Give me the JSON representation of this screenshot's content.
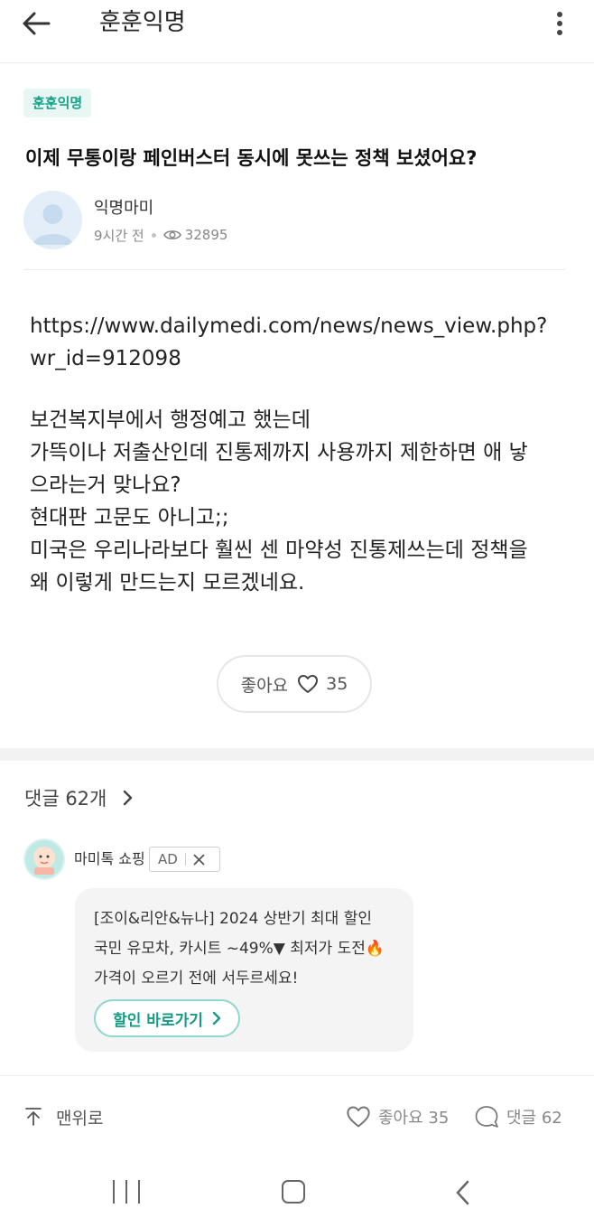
{
  "header": {
    "back_icon": "arrow-left-icon",
    "title": "훈훈익명",
    "more_icon": "more-vertical-icon"
  },
  "post": {
    "board_badge": "훈훈익명",
    "title": "이제 무통이랑 페인버스터 동시에 못쓰는 정책 보셨어요?",
    "author": "익명마미",
    "time": "9시간 전",
    "views": "32895",
    "link_lines": [
      "https://www.dailymedi.com/news/news_view.php?",
      "wr_id=912098"
    ],
    "body_lines": [
      "보건복지부에서 행정예고 했는데",
      "가뜩이나 저출산인데 진통제까지 사용까지 제한하면 애 낳",
      "으라는거 맞나요?",
      "현대판 고문도 아니고;;",
      "미국은 우리나라보다 훨씬 센 마약성 진통제쓰는데 정책을",
      "왜 이렇게 만드는지 모르겠네요."
    ],
    "like_label": "좋아요",
    "like_count": "35"
  },
  "comments": {
    "header": "댓글 62개"
  },
  "ad": {
    "shop_name": "마미톡 쇼핑",
    "ad_label": "AD",
    "lines": [
      "[조이&리안&뉴나] 2024 상반기 최대 할인",
      "국민 유모차, 카시트 ~49%▼ 최저가 도전🔥",
      "가격이 오르기 전에 서두르세요!"
    ],
    "cta_label": "할인 바로가기"
  },
  "bottom_bar": {
    "to_top_label": "맨위로",
    "like_label": "좋아요 35",
    "comment_label": "댓글 62"
  },
  "colors": {
    "accent": "#1aa18a",
    "badge_bg": "#e8f7f4",
    "ad_card_bg": "#f4f4f4",
    "section_gap": "#f2f2f2"
  }
}
